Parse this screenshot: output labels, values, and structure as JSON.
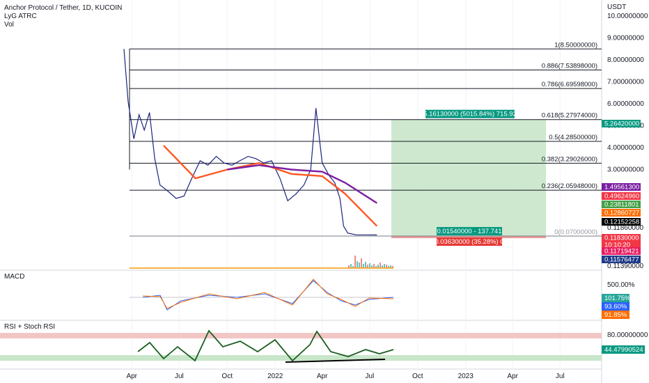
{
  "header": {
    "symbol_line": "Anchor Protocol / Tether, 1D, KUCOIN",
    "indicator_1": "LyG ATRC",
    "indicator_2": "Vol"
  },
  "price_axis": {
    "currency": "USDT",
    "tick_labels": [
      "10.00000000",
      "9.00000000",
      "8.00000000",
      "7.00000000",
      "6.00000000",
      "5.00000000",
      "4.00000000",
      "3.00000000",
      "0.11860000",
      "0.11390000"
    ]
  },
  "fib_levels": [
    {
      "label": "1(8.50000000)",
      "value": 8.5
    },
    {
      "label": "0.886(7.53898000)",
      "value": 7.53898
    },
    {
      "label": "0.786(6.69598000)",
      "value": 6.69598
    },
    {
      "label": "0.618(5.27974000)",
      "value": 5.27974
    },
    {
      "label": "0.5(4.28500000)",
      "value": 4.285
    },
    {
      "label": "0.382(3.29026000)",
      "value": 3.29026
    },
    {
      "label": "0.236(2.05948000)",
      "value": 2.05948
    },
    {
      "label": "0(0.07000000)",
      "value": 0.07
    }
  ],
  "position_box": {
    "target_label": "5.16130000 (5015.84%) 715.92",
    "entry_label": "0.01540000 - 137.741",
    "stop_label": "0.03630000 (35.28%) 0"
  },
  "price_badges": [
    {
      "text": "5.26420000",
      "color": "#089981",
      "text_color": "#ffffff"
    },
    {
      "text": "1.49561300",
      "color": "#7b1fa2",
      "text_color": "#ffffff"
    },
    {
      "text": "0.49624960",
      "color": "#f23645",
      "text_color": "#ffffff"
    },
    {
      "text": "0.23811801",
      "color": "#43a047",
      "text_color": "#ffffff"
    },
    {
      "text": "0.12860727",
      "color": "#ff6d00",
      "text_color": "#ffffff"
    },
    {
      "text": "0.12152258",
      "color": "#000000",
      "text_color": "#ffffff"
    },
    {
      "text": "0.11860000",
      "color": "#ffffff",
      "text_color": "#131722"
    },
    {
      "text": "0.11830000",
      "color": "#f23645",
      "text_color": "#ffffff"
    },
    {
      "text": "10:10:20",
      "color": "#f23645",
      "text_color": "#ffffff"
    },
    {
      "text": "0.11719421",
      "color": "#e91e63",
      "text_color": "#ffffff"
    },
    {
      "text": "0.11576477",
      "color": "#1e3a8a",
      "text_color": "#ffffff"
    },
    {
      "text": "0.11390000",
      "color": "#ffffff",
      "text_color": "#131722"
    }
  ],
  "macd": {
    "title": "MACD",
    "axis_label": "500.00%",
    "badges": [
      {
        "text": "101.75%",
        "color": "#26a69a"
      },
      {
        "text": "93.60%",
        "color": "#2962ff"
      },
      {
        "text": "91.85%",
        "color": "#ff6d00"
      }
    ]
  },
  "rsi": {
    "title": "RSI + Stoch RSI",
    "axis_label": "80.00000000",
    "badge": {
      "text": "44.47990524",
      "color": "#089981"
    }
  },
  "time_axis": {
    "labels": [
      "Apr",
      "Jul",
      "Oct",
      "2022",
      "Apr",
      "Jul",
      "Oct",
      "2023",
      "Apr",
      "Jul"
    ]
  },
  "chart_data": {
    "type": "line",
    "title": "Anchor Protocol / Tether, 1D, KUCOIN",
    "y_unit": "USDT",
    "ylim": [
      0,
      10
    ],
    "x_range": [
      "2021-03-17",
      "2023-08-31"
    ],
    "series": [
      {
        "name": "Anchor Protocol / Tether",
        "x": [
          "2021-03-17",
          "2021-03-25",
          "2021-04-05",
          "2021-04-15",
          "2021-04-25",
          "2021-05-05",
          "2021-05-15",
          "2021-05-25",
          "2021-06-10",
          "2021-06-25",
          "2021-07-10",
          "2021-07-25",
          "2021-08-10",
          "2021-08-25",
          "2021-09-10",
          "2021-09-25",
          "2021-10-10",
          "2021-10-25",
          "2021-11-10",
          "2021-11-25",
          "2021-12-10",
          "2021-12-25",
          "2022-01-10",
          "2022-01-25",
          "2022-02-10",
          "2022-02-25",
          "2022-03-10",
          "2022-03-20",
          "2022-04-01",
          "2022-04-15",
          "2022-04-25",
          "2022-05-05",
          "2022-05-12",
          "2022-05-20",
          "2022-06-05",
          "2022-06-25",
          "2022-07-15"
        ],
        "values": [
          8.5,
          6.1,
          4.4,
          5.5,
          4.8,
          5.6,
          3.5,
          2.3,
          2.0,
          1.7,
          1.8,
          2.6,
          3.4,
          3.2,
          3.6,
          3.3,
          3.2,
          3.4,
          3.6,
          3.5,
          3.3,
          3.4,
          2.6,
          1.6,
          1.9,
          2.3,
          3.0,
          5.8,
          3.3,
          2.7,
          2.4,
          1.7,
          0.5,
          0.2,
          0.12,
          0.12,
          0.118
        ]
      },
      {
        "name": "MA orange",
        "x": [
          "2021-06-01",
          "2021-08-01",
          "2021-10-01",
          "2021-12-01",
          "2022-02-01",
          "2022-04-01",
          "2022-05-15",
          "2022-07-15"
        ],
        "values": [
          4.1,
          2.6,
          3.0,
          3.3,
          2.8,
          2.7,
          1.9,
          0.5
        ]
      },
      {
        "name": "MA purple",
        "x": [
          "2021-10-01",
          "2021-12-01",
          "2022-02-01",
          "2022-04-01",
          "2022-05-15",
          "2022-07-15"
        ],
        "values": [
          3.0,
          3.2,
          3.0,
          2.9,
          2.4,
          1.5
        ]
      }
    ]
  }
}
